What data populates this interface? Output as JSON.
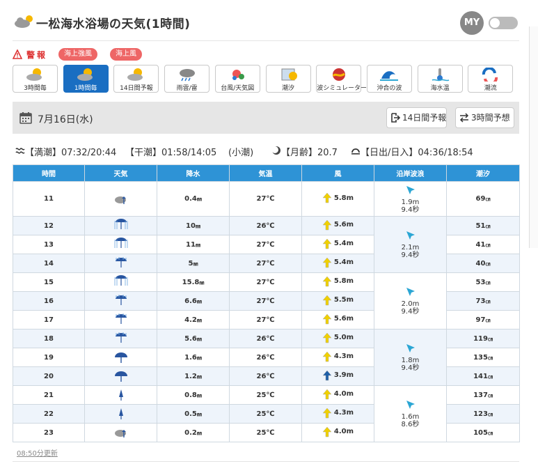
{
  "header": {
    "title": "一松海水浴場の天気(1時間)",
    "my_label": "MY"
  },
  "warnings": {
    "label": "警報",
    "pills": [
      "海上強風",
      "海上風"
    ]
  },
  "nav": [
    {
      "label": "3時間毎",
      "icon": "sun-cloud-icon",
      "active": false
    },
    {
      "label": "1時間毎",
      "icon": "sun-cloud-icon",
      "active": true
    },
    {
      "label": "14日間予報",
      "icon": "sun-cloud-icon",
      "active": false
    },
    {
      "label": "雨雲/雷",
      "icon": "rain-cloud-icon",
      "active": false
    },
    {
      "label": "台風/天気図",
      "icon": "typhoon-map-icon",
      "active": false
    },
    {
      "label": "潮汐",
      "icon": "tide-icon",
      "active": false
    },
    {
      "label": "波シミュレーター",
      "icon": "wave-simulator-icon",
      "active": false
    },
    {
      "label": "沖合の波",
      "icon": "offshore-wave-icon",
      "active": false
    },
    {
      "label": "海水温",
      "icon": "sea-temp-icon",
      "active": false
    },
    {
      "label": "潮流",
      "icon": "current-icon",
      "active": false
    }
  ],
  "date_bar": {
    "date": "7月16日(水)",
    "btn_14day": "14日間予報",
    "btn_3hour": "3時間予想"
  },
  "tide_info": {
    "high": "【満潮】07:32/20:44",
    "low": "【干潮】01:58/14:05",
    "type": "(小潮)",
    "moon": "【月齢】20.7",
    "sun": "【日出/日入】04:36/18:54"
  },
  "table": {
    "headers": [
      "時間",
      "天気",
      "降水",
      "気温",
      "風",
      "沿岸波浪",
      "潮汐"
    ],
    "rows": [
      {
        "hour": "11",
        "weather": "cloud-rain-icon",
        "precip": "0.4",
        "temp": "27",
        "wind": "5.8m",
        "wind_color": "#f0d000",
        "tide": "69"
      },
      {
        "hour": "12",
        "weather": "heavy-rain-icon",
        "precip": "10",
        "temp": "26",
        "wind": "5.6m",
        "wind_color": "#f0d000",
        "tide": "51"
      },
      {
        "hour": "13",
        "weather": "heavy-rain-icon",
        "precip": "11",
        "temp": "27",
        "wind": "5.4m",
        "wind_color": "#f0d000",
        "tide": "41"
      },
      {
        "hour": "14",
        "weather": "umbrella-rain-icon",
        "precip": "5",
        "temp": "27",
        "wind": "5.4m",
        "wind_color": "#f0d000",
        "tide": "40"
      },
      {
        "hour": "15",
        "weather": "heavy-rain-icon",
        "precip": "15.8",
        "temp": "27",
        "wind": "5.8m",
        "wind_color": "#f0d000",
        "tide": "53"
      },
      {
        "hour": "16",
        "weather": "umbrella-rain-icon",
        "precip": "6.6",
        "temp": "27",
        "wind": "5.5m",
        "wind_color": "#f0d000",
        "tide": "73"
      },
      {
        "hour": "17",
        "weather": "umbrella-rain-icon",
        "precip": "4.2",
        "temp": "27",
        "wind": "5.6m",
        "wind_color": "#f0d000",
        "tide": "97"
      },
      {
        "hour": "18",
        "weather": "umbrella-rain-icon",
        "precip": "5.6",
        "temp": "26",
        "wind": "5.0m",
        "wind_color": "#f0d000",
        "tide": "119"
      },
      {
        "hour": "19",
        "weather": "umbrella-icon",
        "precip": "1.6",
        "temp": "26",
        "wind": "4.3m",
        "wind_color": "#f0d000",
        "tide": "135"
      },
      {
        "hour": "20",
        "weather": "umbrella-icon",
        "precip": "1.2",
        "temp": "26",
        "wind": "3.9m",
        "wind_color": "#1f5fa8",
        "tide": "141"
      },
      {
        "hour": "21",
        "weather": "closed-umbrella-icon",
        "precip": "0.8",
        "temp": "25",
        "wind": "4.0m",
        "wind_color": "#f0d000",
        "tide": "137"
      },
      {
        "hour": "22",
        "weather": "closed-umbrella-icon",
        "precip": "0.5",
        "temp": "25",
        "wind": "4.3m",
        "wind_color": "#f0d000",
        "tide": "123"
      },
      {
        "hour": "23",
        "weather": "cloud-rain-icon",
        "precip": "0.2",
        "temp": "25",
        "wind": "4.0m",
        "wind_color": "#f0d000",
        "tide": "105"
      }
    ],
    "waves": [
      {
        "height": "1.9m",
        "period": "9.4秒"
      },
      {
        "height": "2.1m",
        "period": "9.4秒"
      },
      {
        "height": "2.0m",
        "period": "9.4秒"
      },
      {
        "height": "1.8m",
        "period": "9.4秒"
      },
      {
        "height": "1.6m",
        "period": "8.6秒"
      }
    ],
    "units": {
      "precip": "㎜",
      "temp": "℃",
      "tide": "㎝"
    }
  },
  "footer": {
    "updated": "08:50分更新"
  },
  "colors": {
    "accent": "#1a6ec2",
    "header_bg": "#2e93d6",
    "alert": "#e66",
    "arrow_yellow": "#f0d000",
    "wave_arrow": "#2ba6d4"
  }
}
